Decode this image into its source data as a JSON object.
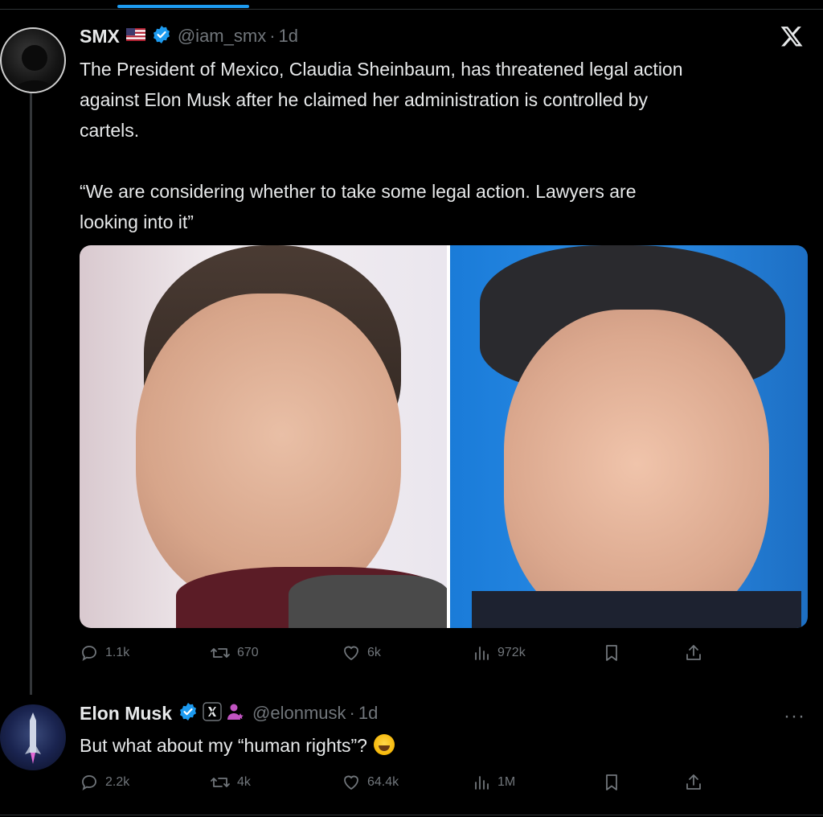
{
  "tweet1": {
    "author_name": "SMX",
    "flag_icon": "us-flag-emoji",
    "handle": "@iam_smx",
    "separator": "·",
    "time": "1d",
    "text": "The President of Mexico, Claudia Sheinbaum, has threatened legal action\nagainst Elon Musk after he claimed her administration is controlled by\ncartels.\n\n“We are considering whether to take some legal action. Lawyers are\nlooking into it”",
    "replies": "1.1k",
    "reposts": "670",
    "likes": "6k",
    "views": "972k"
  },
  "tweet2": {
    "author_name": "Elon Musk",
    "handle": "@elonmusk",
    "separator": "·",
    "time": "1d",
    "text": "But what about my “human rights”?",
    "emoji": "face-with-tears-of-joy",
    "replies": "2.2k",
    "reposts": "4k",
    "likes": "64.4k",
    "views": "1M"
  },
  "colors": {
    "background": "#000000",
    "text": "#e7e9ea",
    "muted": "#71767b",
    "verified": "#1d9bf0",
    "accent": "#1d9bf0"
  }
}
